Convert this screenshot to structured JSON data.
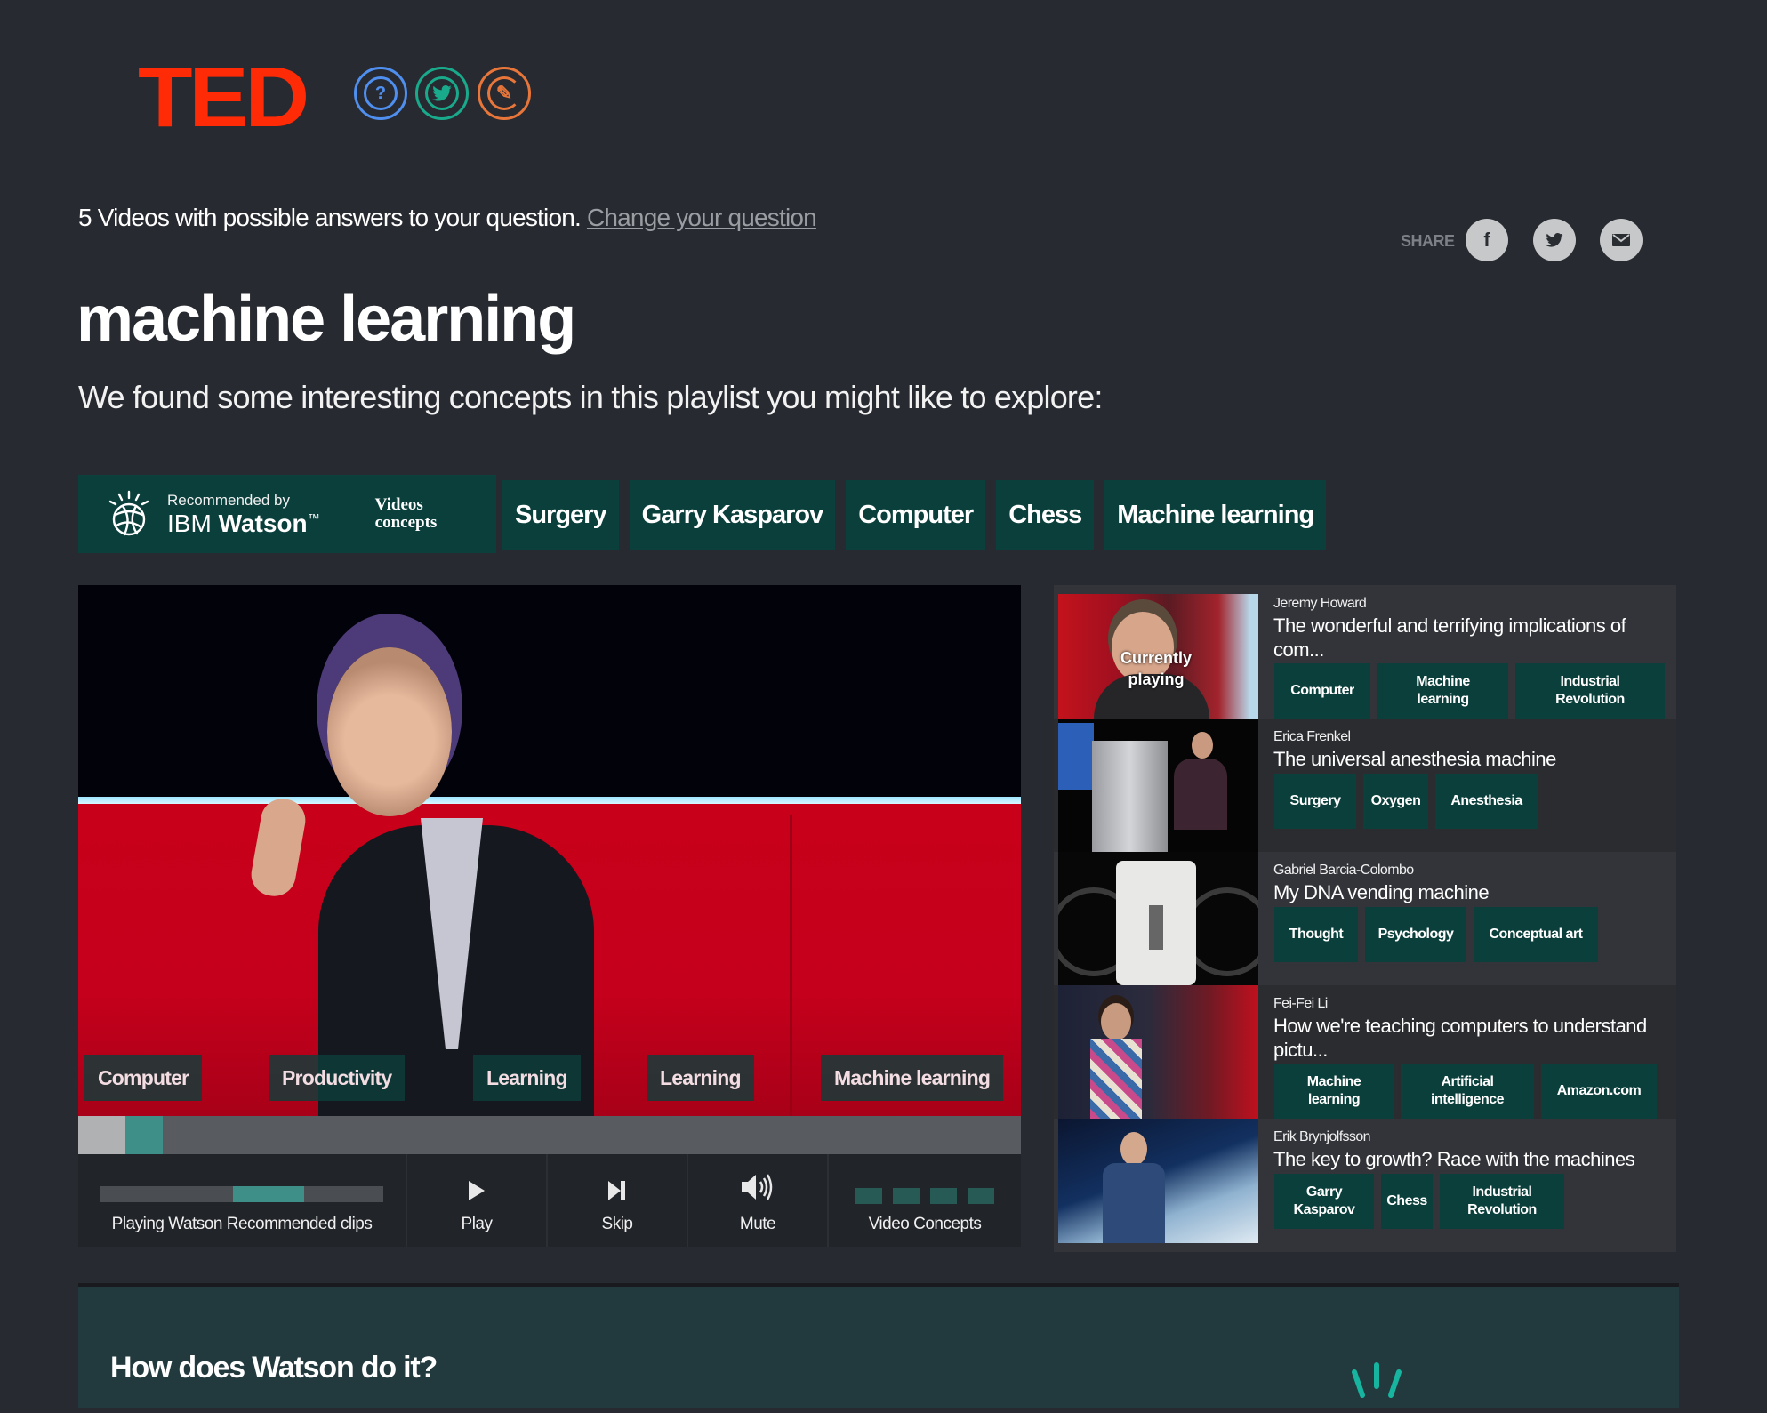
{
  "header": {
    "logo": "TED",
    "icons": [
      {
        "name": "question-bubble-icon",
        "glyph": "?",
        "color": "#4f8ff0"
      },
      {
        "name": "twitter-icon",
        "glyph": "🐦",
        "color": "#19a98b"
      },
      {
        "name": "pencil-icon",
        "glyph": "✎",
        "color": "#e8763a"
      }
    ]
  },
  "intro": {
    "answers_text": "5 Videos with possible answers to your question.",
    "change_link": "Change your question"
  },
  "share": {
    "label": "SHARE",
    "buttons": [
      {
        "name": "facebook",
        "glyph": "f"
      },
      {
        "name": "twitter",
        "glyph": "🐦"
      },
      {
        "name": "email",
        "glyph": "✉"
      }
    ]
  },
  "page": {
    "title": "machine learning",
    "subtitle": "We found some interesting concepts in this playlist you might like to explore:"
  },
  "watson": {
    "recommended_by": "Recommended by",
    "brand_light": "IBM",
    "brand_bold": "Watson",
    "trademark": "™",
    "videos_concepts_line1": "Videos",
    "videos_concepts_line2": "concepts"
  },
  "concepts": [
    "Surgery",
    "Garry Kasparov",
    "Computer",
    "Chess",
    "Machine learning"
  ],
  "video": {
    "overlay_tags": [
      "Computer",
      "Productivity",
      "Learning",
      "Learning",
      "Machine learning"
    ],
    "progress_played_fraction": 0.05,
    "clip_fraction": 0.04
  },
  "controls": {
    "playing_label": "Playing Watson Recommended clips",
    "clip_progress_start": 0.47,
    "clip_progress_width": 0.25,
    "play_label": "Play",
    "skip_label": "Skip",
    "mute_label": "Mute",
    "concepts_label": "Video Concepts"
  },
  "playlist": [
    {
      "speaker": "Jeremy Howard",
      "title": "The wonderful and terrifying implications of com...",
      "now_playing": "Currently playing",
      "tags": [
        "Computer",
        "Machine learning",
        "Industrial Revolution"
      ]
    },
    {
      "speaker": "Erica Frenkel",
      "title": "The universal anesthesia machine",
      "tags": [
        "Surgery",
        "Oxygen",
        "Anesthesia"
      ]
    },
    {
      "speaker": "Gabriel Barcia-Colombo",
      "title": "My DNA vending machine",
      "tags": [
        "Thought",
        "Psychology",
        "Conceptual art"
      ]
    },
    {
      "speaker": "Fei-Fei Li",
      "title": "How we're teaching computers to understand pictu...",
      "tags": [
        "Machine learning",
        "Artificial intelligence",
        "Amazon.com"
      ]
    },
    {
      "speaker": "Erik Brynjolfsson",
      "title": "The key to growth? Race with the machines",
      "tags": [
        "Garry Kasparov",
        "Chess",
        "Industrial Revolution"
      ]
    }
  ],
  "how": {
    "title": "How does Watson do it?"
  },
  "colors": {
    "background": "#272a30",
    "ted_red": "#ff2b06",
    "concept_green": "#0b3f3b",
    "progress_teal": "#3e8f88",
    "watson_teal": "#17b5a0"
  }
}
